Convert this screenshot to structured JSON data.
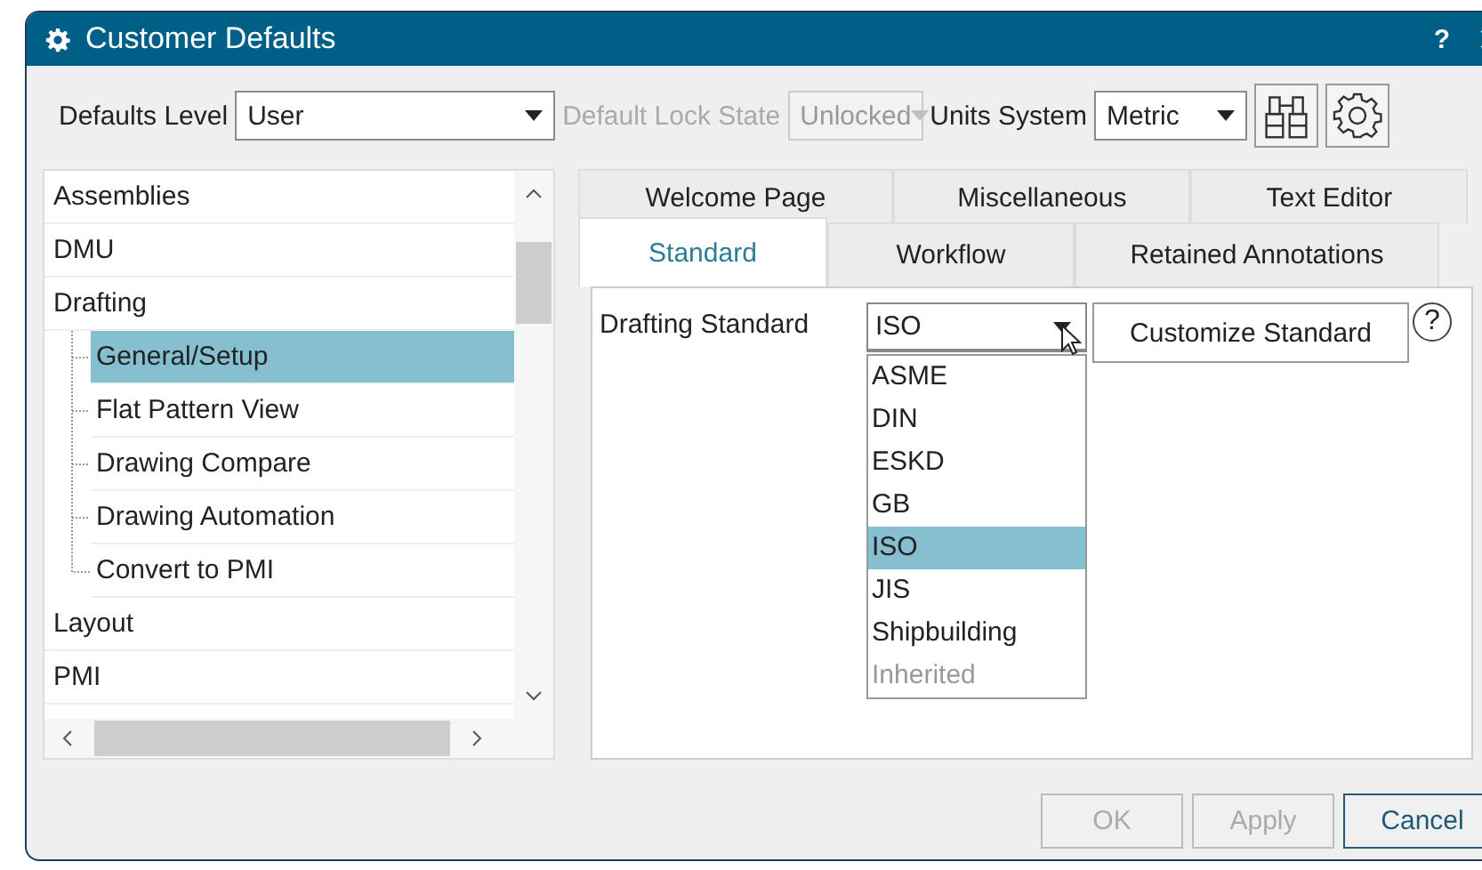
{
  "window": {
    "title": "Customer Defaults",
    "help": "?"
  },
  "toolbar": {
    "fields": [
      {
        "label": "Defaults Level",
        "value": "User",
        "disabled": false
      },
      {
        "label": "Default Lock State",
        "value": "Unlocked",
        "disabled": true
      },
      {
        "label": "Units System",
        "value": "Metric",
        "disabled": false
      }
    ]
  },
  "tree": {
    "items": [
      {
        "label": "Assemblies",
        "selected": false
      },
      {
        "label": "DMU",
        "selected": false
      },
      {
        "label": "Drafting",
        "selected": false,
        "expanded": true,
        "children": [
          {
            "label": "General/Setup",
            "selected": true
          },
          {
            "label": "Flat Pattern View",
            "selected": false
          },
          {
            "label": "Drawing Compare",
            "selected": false
          },
          {
            "label": "Drawing Automation",
            "selected": false
          },
          {
            "label": "Convert to PMI",
            "selected": false
          }
        ]
      },
      {
        "label": "Layout",
        "selected": false
      },
      {
        "label": "PMI",
        "selected": false
      }
    ]
  },
  "tabs": [
    [
      {
        "label": "Welcome Page",
        "selected": false
      },
      {
        "label": "Miscellaneous",
        "selected": false
      },
      {
        "label": "Text Editor",
        "selected": false
      }
    ],
    [
      {
        "label": "Standard",
        "selected": true
      },
      {
        "label": "Workflow",
        "selected": false
      },
      {
        "label": "Retained Annotations",
        "selected": false
      }
    ]
  ],
  "standard": {
    "label": "Drafting Standard",
    "value": "ISO",
    "button": "Customize Standard",
    "help": "?",
    "options": [
      {
        "label": "ASME",
        "selected": false,
        "disabled": false
      },
      {
        "label": "DIN",
        "selected": false,
        "disabled": false
      },
      {
        "label": "ESKD",
        "selected": false,
        "disabled": false
      },
      {
        "label": "GB",
        "selected": false,
        "disabled": false
      },
      {
        "label": "ISO",
        "selected": true,
        "disabled": false
      },
      {
        "label": "JIS",
        "selected": false,
        "disabled": false
      },
      {
        "label": "Shipbuilding",
        "selected": false,
        "disabled": false
      },
      {
        "label": "Inherited",
        "selected": false,
        "disabled": true
      }
    ]
  },
  "buttons": [
    {
      "label": "OK",
      "disabled": true,
      "default": false
    },
    {
      "label": "Apply",
      "disabled": true,
      "default": false
    },
    {
      "label": "Cancel",
      "disabled": false,
      "default": true
    }
  ]
}
